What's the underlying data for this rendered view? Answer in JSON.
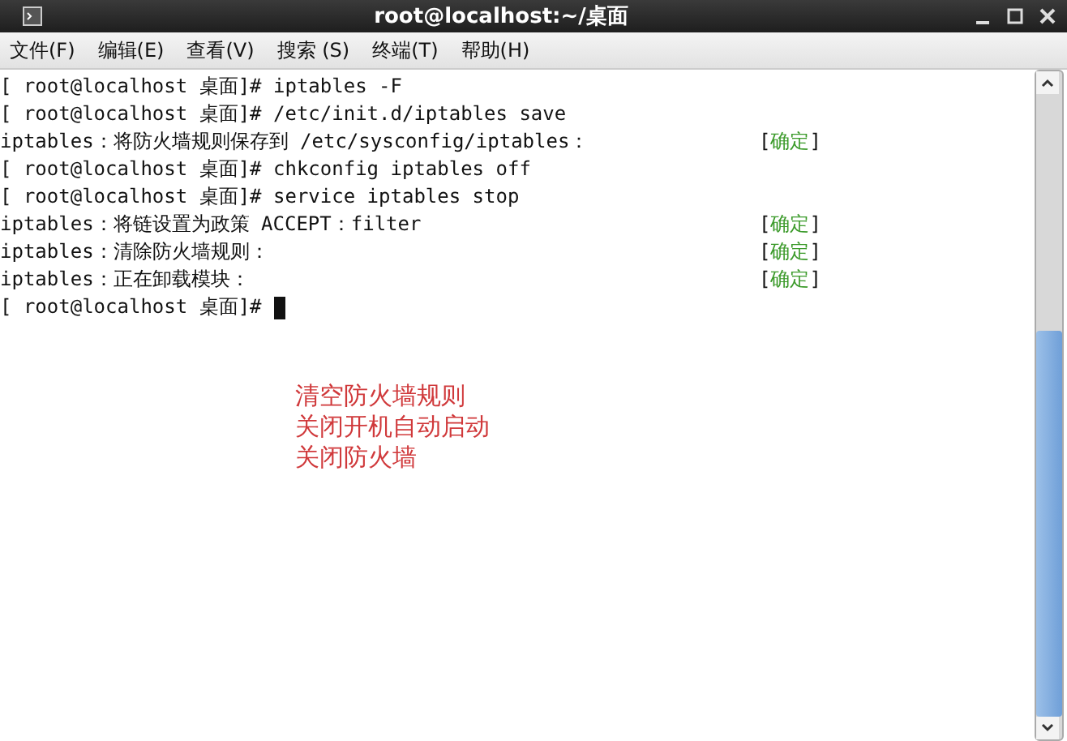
{
  "window": {
    "title": "root@localhost:~/桌面"
  },
  "menu": [
    "文件(F)",
    "编辑(E)",
    "查看(V)",
    "搜索 (S)",
    "终端(T)",
    "帮助(H)"
  ],
  "lines": [
    {
      "text": "[ root@localhost 桌面]# iptables -F"
    },
    {
      "text": "[ root@localhost 桌面]# /etc/init.d/iptables save"
    },
    {
      "text": "iptables：将防火墙规则保存到 /etc/sysconfig/iptables：",
      "status": {
        "open": "[",
        "word": "确定",
        "close": "]"
      }
    },
    {
      "text": "[ root@localhost 桌面]# chkconfig iptables off"
    },
    {
      "text": "[ root@localhost 桌面]# service iptables stop"
    },
    {
      "text": "iptables：将链设置为政策 ACCEPT：filter",
      "status": {
        "open": "[",
        "word": "确定",
        "close": "]"
      }
    },
    {
      "text": "iptables：清除防火墙规则：",
      "status": {
        "open": "[",
        "word": "确定",
        "close": "]"
      }
    },
    {
      "text": "iptables：正在卸载模块：",
      "status": {
        "open": "[",
        "word": "确定",
        "close": "]"
      }
    },
    {
      "text": "[ root@localhost 桌面]#",
      "cursor": true
    }
  ],
  "notes": [
    "清空防火墙规则",
    "关闭开机自动启动",
    "关闭防火墙"
  ]
}
